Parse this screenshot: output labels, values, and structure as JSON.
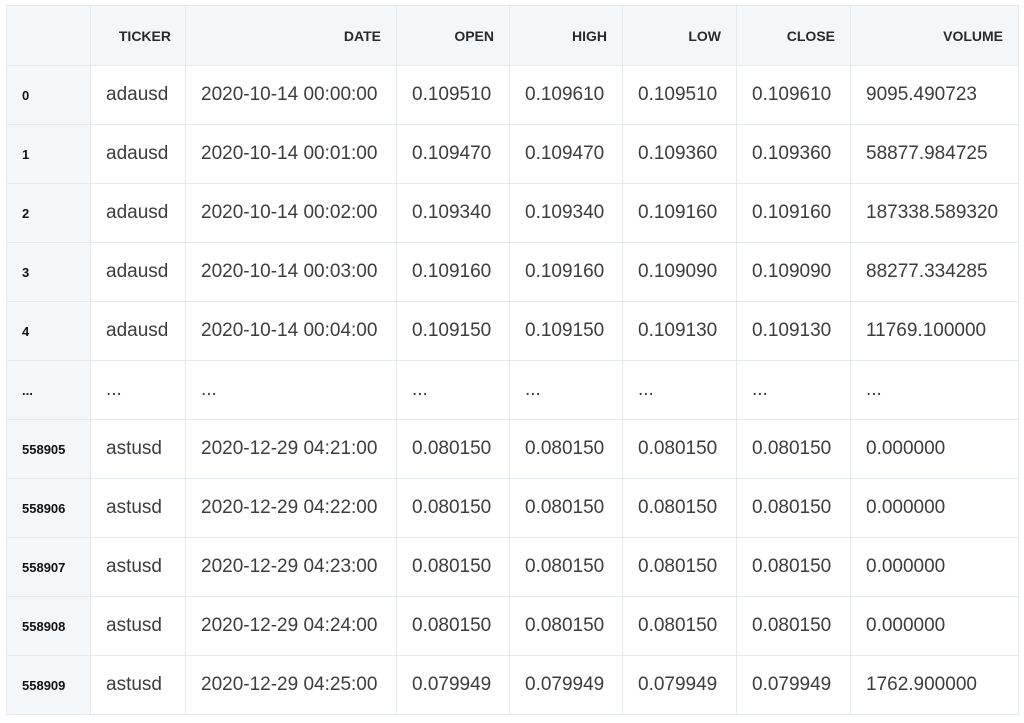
{
  "table": {
    "columns": [
      "",
      "TICKER",
      "DATE",
      "OPEN",
      "HIGH",
      "LOW",
      "CLOSE",
      "VOLUME"
    ],
    "rows": [
      {
        "index": "0",
        "cells": [
          "adausd",
          "2020-10-14 00:00:00",
          "0.109510",
          "0.109610",
          "0.109510",
          "0.109610",
          "9095.490723"
        ]
      },
      {
        "index": "1",
        "cells": [
          "adausd",
          "2020-10-14 00:01:00",
          "0.109470",
          "0.109470",
          "0.109360",
          "0.109360",
          "58877.984725"
        ]
      },
      {
        "index": "2",
        "cells": [
          "adausd",
          "2020-10-14 00:02:00",
          "0.109340",
          "0.109340",
          "0.109160",
          "0.109160",
          "187338.589320"
        ]
      },
      {
        "index": "3",
        "cells": [
          "adausd",
          "2020-10-14 00:03:00",
          "0.109160",
          "0.109160",
          "0.109090",
          "0.109090",
          "88277.334285"
        ]
      },
      {
        "index": "4",
        "cells": [
          "adausd",
          "2020-10-14 00:04:00",
          "0.109150",
          "0.109150",
          "0.109130",
          "0.109130",
          "11769.100000"
        ]
      },
      {
        "index": "...",
        "cells": [
          "...",
          "...",
          "...",
          "...",
          "...",
          "...",
          "..."
        ]
      },
      {
        "index": "558905",
        "cells": [
          "astusd",
          "2020-12-29 04:21:00",
          "0.080150",
          "0.080150",
          "0.080150",
          "0.080150",
          "0.000000"
        ]
      },
      {
        "index": "558906",
        "cells": [
          "astusd",
          "2020-12-29 04:22:00",
          "0.080150",
          "0.080150",
          "0.080150",
          "0.080150",
          "0.000000"
        ]
      },
      {
        "index": "558907",
        "cells": [
          "astusd",
          "2020-12-29 04:23:00",
          "0.080150",
          "0.080150",
          "0.080150",
          "0.080150",
          "0.000000"
        ]
      },
      {
        "index": "558908",
        "cells": [
          "astusd",
          "2020-12-29 04:24:00",
          "0.080150",
          "0.080150",
          "0.080150",
          "0.080150",
          "0.000000"
        ]
      },
      {
        "index": "558909",
        "cells": [
          "astusd",
          "2020-12-29 04:25:00",
          "0.079949",
          "0.079949",
          "0.079949",
          "0.079949",
          "1762.900000"
        ]
      }
    ]
  }
}
